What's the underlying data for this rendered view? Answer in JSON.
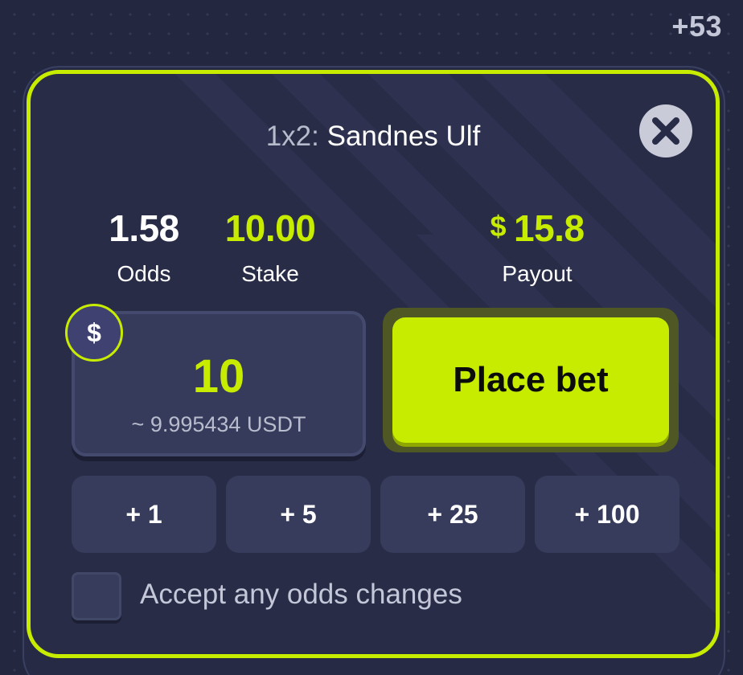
{
  "header": {
    "counter": "+53"
  },
  "bet": {
    "market": "1x2:",
    "selection": "Sandnes Ulf"
  },
  "stats": {
    "odds_value": "1.58",
    "odds_label": "Odds",
    "stake_value": "10.00",
    "stake_label": "Stake",
    "payout_currency": "$",
    "payout_value": "15.8",
    "payout_label": "Payout"
  },
  "amount": {
    "currency_symbol": "$",
    "value": "10",
    "converted": "~ 9.995434 USDT"
  },
  "actions": {
    "place_bet_label": "Place bet"
  },
  "quick_stakes": [
    "+ 1",
    "+ 5",
    "+ 25",
    "+ 100"
  ],
  "options": {
    "accept_odds_label": "Accept any odds changes",
    "accept_odds_checked": false
  },
  "colors": {
    "accent": "#c8ec00",
    "background": "#23273f",
    "panel": "#282c47",
    "chip": "#373c5c"
  },
  "icons": {
    "close": "close-icon",
    "currency": "dollar-icon"
  }
}
